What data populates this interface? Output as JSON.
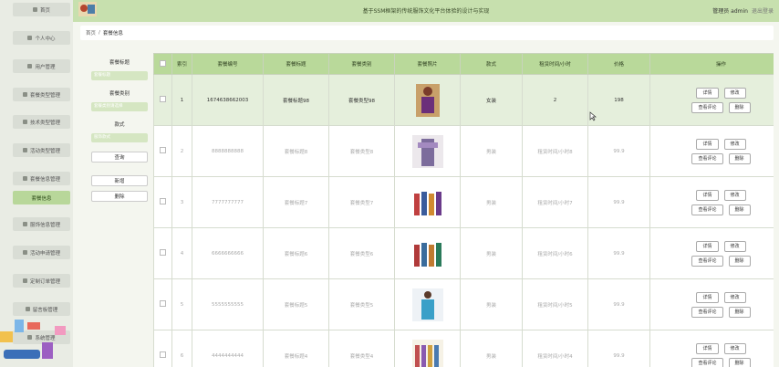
{
  "app": {
    "title": "基于SSM框架的传统服饰文化平台体验的设计与实现",
    "user_label": "管理员 admin",
    "logout": "退出登录"
  },
  "sidebar": {
    "items": [
      {
        "label": "首页"
      },
      {
        "label": "个人中心"
      },
      {
        "label": "用户管理"
      },
      {
        "label": "套餐类型管理"
      },
      {
        "label": "技术类型管理"
      },
      {
        "label": "活动类型管理"
      },
      {
        "label": "套餐信息管理"
      },
      {
        "label": "套餐信息"
      },
      {
        "label": "服饰信息管理"
      },
      {
        "label": "活动申请管理"
      },
      {
        "label": "定制订单管理"
      },
      {
        "label": "留言板管理"
      },
      {
        "label": "系统管理"
      }
    ]
  },
  "breadcrumb": {
    "home": "首页",
    "sep": "/",
    "current": "套餐信息"
  },
  "search": {
    "label1": "套餐标题",
    "placeholder1": "套餐标题",
    "label2": "套餐类别",
    "placeholder2": "套餐类别请选择",
    "label3": "款式",
    "placeholder3": "服饰款式",
    "query": "查询",
    "add": "新增",
    "delete": "删除"
  },
  "table": {
    "headers": [
      "索引",
      "套餐编号",
      "套餐标题",
      "套餐类别",
      "套餐照片",
      "款式",
      "租赁时间/小时",
      "价格",
      "操作"
    ],
    "rows": [
      {
        "index": "1",
        "code": "1674638662003",
        "title": "套餐标题98",
        "category": "套餐类型98",
        "style": "女装",
        "hours": "2",
        "price": "198"
      },
      {
        "index": "2",
        "code": "8888888888",
        "title": "套餐标题8",
        "category": "套餐类型8",
        "style": "男装",
        "hours": "租赁时间/小时8",
        "price": "99.9"
      },
      {
        "index": "3",
        "code": "7777777777",
        "title": "套餐标题7",
        "category": "套餐类型7",
        "style": "男装",
        "hours": "租赁时间/小时7",
        "price": "99.9"
      },
      {
        "index": "4",
        "code": "6666666666",
        "title": "套餐标题6",
        "category": "套餐类型6",
        "style": "男装",
        "hours": "租赁时间/小时6",
        "price": "99.9"
      },
      {
        "index": "5",
        "code": "5555555555",
        "title": "套餐标题5",
        "category": "套餐类型5",
        "style": "男装",
        "hours": "租赁时间/小时5",
        "price": "99.9"
      },
      {
        "index": "6",
        "code": "4444444444",
        "title": "套餐标题4",
        "category": "套餐类型4",
        "style": "男装",
        "hours": "租赁时间/小时4",
        "price": "99.9"
      }
    ],
    "actions": {
      "detail": "详情",
      "edit": "修改",
      "comments": "查看评论",
      "delete": "删除"
    }
  },
  "colors": {
    "accent": "#b9d99a",
    "header": "#c7e0ae",
    "active_nav": "#b8d79a"
  }
}
